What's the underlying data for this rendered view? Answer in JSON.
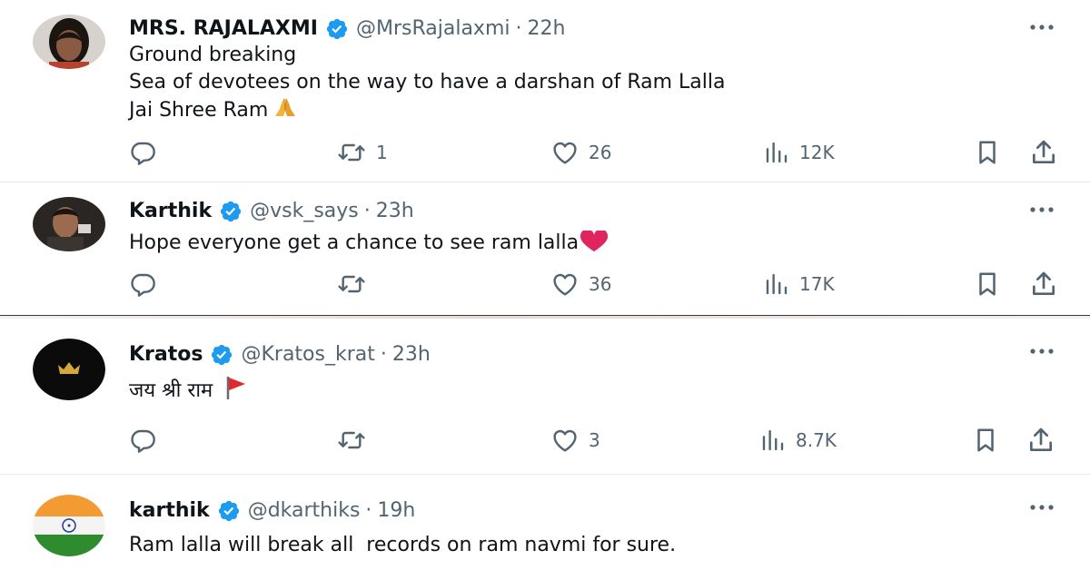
{
  "tweets": [
    {
      "name": "MRS. RAJALAXMI",
      "handle": "@MrsRajalaxmi",
      "time": "22h",
      "lines": [
        "Ground breaking",
        "Sea of devotees on the way to have a darshan of Ram Lalla",
        "Jai Shree Ram"
      ],
      "emoji": "folded-hands",
      "replies": "",
      "retweets": "1",
      "likes": "26",
      "views": "12K",
      "verified": true
    },
    {
      "name": "Karthik",
      "handle": "@vsk_says",
      "time": "23h",
      "lines": [
        "Hope everyone get a chance to see ram lalla"
      ],
      "emoji": "red-heart",
      "replies": "",
      "retweets": "",
      "likes": "36",
      "views": "17K",
      "verified": true
    },
    {
      "name": "Kratos",
      "handle": "@Kratos_krat",
      "time": "23h",
      "lines": [
        "जय श्री राम"
      ],
      "emoji": "red-flag",
      "replies": "",
      "retweets": "",
      "likes": "3",
      "views": "8.7K",
      "verified": true
    },
    {
      "name": "karthik",
      "handle": "@dkarthiks",
      "time": "19h",
      "lines": [
        "Ram lalla will break all  records on ram navmi for sure."
      ],
      "verified": true
    }
  ],
  "separator": "·",
  "colors": {
    "verified": "#1d9bf0",
    "muted": "#536471",
    "text": "#0f1419",
    "heart": "#e0245e"
  },
  "icons": [
    "reply-icon",
    "retweet-icon",
    "like-icon",
    "views-icon",
    "bookmark-icon",
    "share-icon",
    "more-icon",
    "verified-badge-icon"
  ]
}
